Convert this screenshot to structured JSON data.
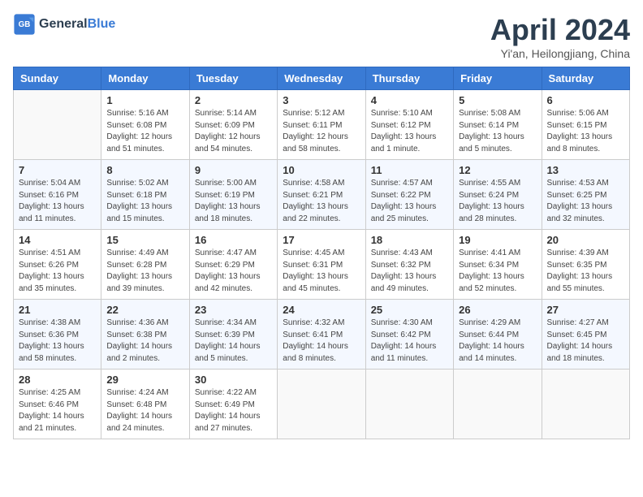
{
  "header": {
    "logo_line1": "General",
    "logo_line2": "Blue",
    "month": "April 2024",
    "location": "Yi'an, Heilongjiang, China"
  },
  "days_of_week": [
    "Sunday",
    "Monday",
    "Tuesday",
    "Wednesday",
    "Thursday",
    "Friday",
    "Saturday"
  ],
  "weeks": [
    [
      {
        "day": "",
        "info": ""
      },
      {
        "day": "1",
        "info": "Sunrise: 5:16 AM\nSunset: 6:08 PM\nDaylight: 12 hours\nand 51 minutes."
      },
      {
        "day": "2",
        "info": "Sunrise: 5:14 AM\nSunset: 6:09 PM\nDaylight: 12 hours\nand 54 minutes."
      },
      {
        "day": "3",
        "info": "Sunrise: 5:12 AM\nSunset: 6:11 PM\nDaylight: 12 hours\nand 58 minutes."
      },
      {
        "day": "4",
        "info": "Sunrise: 5:10 AM\nSunset: 6:12 PM\nDaylight: 13 hours\nand 1 minute."
      },
      {
        "day": "5",
        "info": "Sunrise: 5:08 AM\nSunset: 6:14 PM\nDaylight: 13 hours\nand 5 minutes."
      },
      {
        "day": "6",
        "info": "Sunrise: 5:06 AM\nSunset: 6:15 PM\nDaylight: 13 hours\nand 8 minutes."
      }
    ],
    [
      {
        "day": "7",
        "info": "Sunrise: 5:04 AM\nSunset: 6:16 PM\nDaylight: 13 hours\nand 11 minutes."
      },
      {
        "day": "8",
        "info": "Sunrise: 5:02 AM\nSunset: 6:18 PM\nDaylight: 13 hours\nand 15 minutes."
      },
      {
        "day": "9",
        "info": "Sunrise: 5:00 AM\nSunset: 6:19 PM\nDaylight: 13 hours\nand 18 minutes."
      },
      {
        "day": "10",
        "info": "Sunrise: 4:58 AM\nSunset: 6:21 PM\nDaylight: 13 hours\nand 22 minutes."
      },
      {
        "day": "11",
        "info": "Sunrise: 4:57 AM\nSunset: 6:22 PM\nDaylight: 13 hours\nand 25 minutes."
      },
      {
        "day": "12",
        "info": "Sunrise: 4:55 AM\nSunset: 6:24 PM\nDaylight: 13 hours\nand 28 minutes."
      },
      {
        "day": "13",
        "info": "Sunrise: 4:53 AM\nSunset: 6:25 PM\nDaylight: 13 hours\nand 32 minutes."
      }
    ],
    [
      {
        "day": "14",
        "info": "Sunrise: 4:51 AM\nSunset: 6:26 PM\nDaylight: 13 hours\nand 35 minutes."
      },
      {
        "day": "15",
        "info": "Sunrise: 4:49 AM\nSunset: 6:28 PM\nDaylight: 13 hours\nand 39 minutes."
      },
      {
        "day": "16",
        "info": "Sunrise: 4:47 AM\nSunset: 6:29 PM\nDaylight: 13 hours\nand 42 minutes."
      },
      {
        "day": "17",
        "info": "Sunrise: 4:45 AM\nSunset: 6:31 PM\nDaylight: 13 hours\nand 45 minutes."
      },
      {
        "day": "18",
        "info": "Sunrise: 4:43 AM\nSunset: 6:32 PM\nDaylight: 13 hours\nand 49 minutes."
      },
      {
        "day": "19",
        "info": "Sunrise: 4:41 AM\nSunset: 6:34 PM\nDaylight: 13 hours\nand 52 minutes."
      },
      {
        "day": "20",
        "info": "Sunrise: 4:39 AM\nSunset: 6:35 PM\nDaylight: 13 hours\nand 55 minutes."
      }
    ],
    [
      {
        "day": "21",
        "info": "Sunrise: 4:38 AM\nSunset: 6:36 PM\nDaylight: 13 hours\nand 58 minutes."
      },
      {
        "day": "22",
        "info": "Sunrise: 4:36 AM\nSunset: 6:38 PM\nDaylight: 14 hours\nand 2 minutes."
      },
      {
        "day": "23",
        "info": "Sunrise: 4:34 AM\nSunset: 6:39 PM\nDaylight: 14 hours\nand 5 minutes."
      },
      {
        "day": "24",
        "info": "Sunrise: 4:32 AM\nSunset: 6:41 PM\nDaylight: 14 hours\nand 8 minutes."
      },
      {
        "day": "25",
        "info": "Sunrise: 4:30 AM\nSunset: 6:42 PM\nDaylight: 14 hours\nand 11 minutes."
      },
      {
        "day": "26",
        "info": "Sunrise: 4:29 AM\nSunset: 6:44 PM\nDaylight: 14 hours\nand 14 minutes."
      },
      {
        "day": "27",
        "info": "Sunrise: 4:27 AM\nSunset: 6:45 PM\nDaylight: 14 hours\nand 18 minutes."
      }
    ],
    [
      {
        "day": "28",
        "info": "Sunrise: 4:25 AM\nSunset: 6:46 PM\nDaylight: 14 hours\nand 21 minutes."
      },
      {
        "day": "29",
        "info": "Sunrise: 4:24 AM\nSunset: 6:48 PM\nDaylight: 14 hours\nand 24 minutes."
      },
      {
        "day": "30",
        "info": "Sunrise: 4:22 AM\nSunset: 6:49 PM\nDaylight: 14 hours\nand 27 minutes."
      },
      {
        "day": "",
        "info": ""
      },
      {
        "day": "",
        "info": ""
      },
      {
        "day": "",
        "info": ""
      },
      {
        "day": "",
        "info": ""
      }
    ]
  ]
}
